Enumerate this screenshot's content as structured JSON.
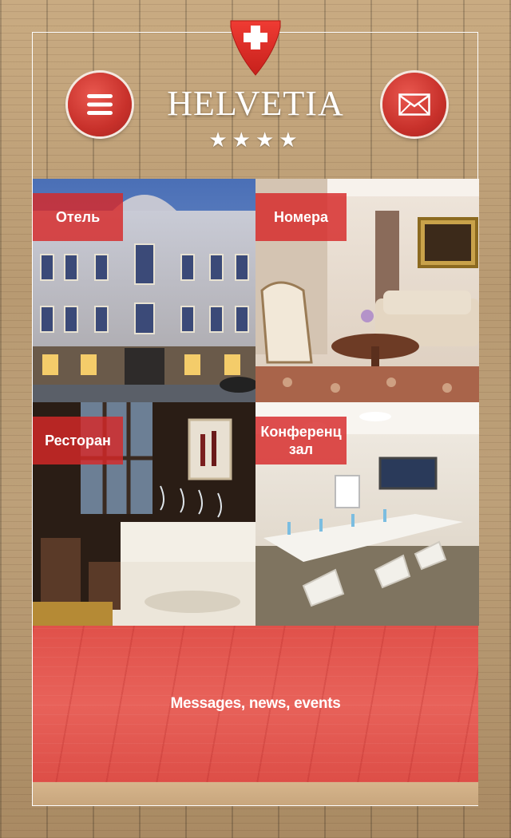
{
  "header": {
    "logo_text": "HELVETIA",
    "stars": "★★★★",
    "menu_icon": "hamburger-menu-icon",
    "mail_icon": "envelope-icon",
    "emblem_icon": "swiss-cross-shield-icon"
  },
  "tiles": [
    {
      "label": "Отель"
    },
    {
      "label": "Номера"
    },
    {
      "label": "Ресторан"
    },
    {
      "label": "Конференц зал"
    }
  ],
  "news": {
    "label": "Messages, news, events"
  },
  "colors": {
    "accent_red": "#d62a2a",
    "news_red": "#e35a52",
    "wood": "#c2a37a"
  }
}
